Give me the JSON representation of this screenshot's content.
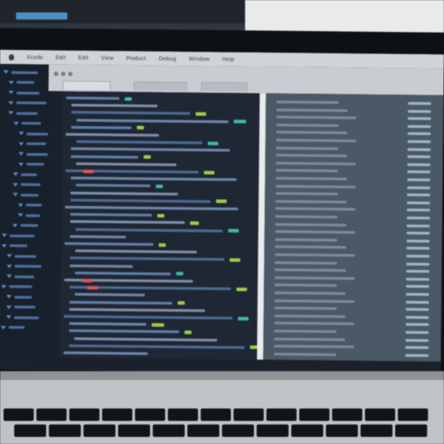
{
  "image": {
    "subject": "photo-of-laptop-screen",
    "menubar": {
      "items": [
        "Xcode",
        "Edit",
        "Edit",
        "View",
        "Product",
        "Debug",
        "Window",
        "Help"
      ]
    },
    "colors": {
      "code_background": "#1f2634",
      "output_background": "#4b5866",
      "keyword_green": "#9acd4a",
      "token_teal": "#3fb7a8",
      "token_red": "#d8555a",
      "menubar": "#cfd4d8"
    }
  }
}
